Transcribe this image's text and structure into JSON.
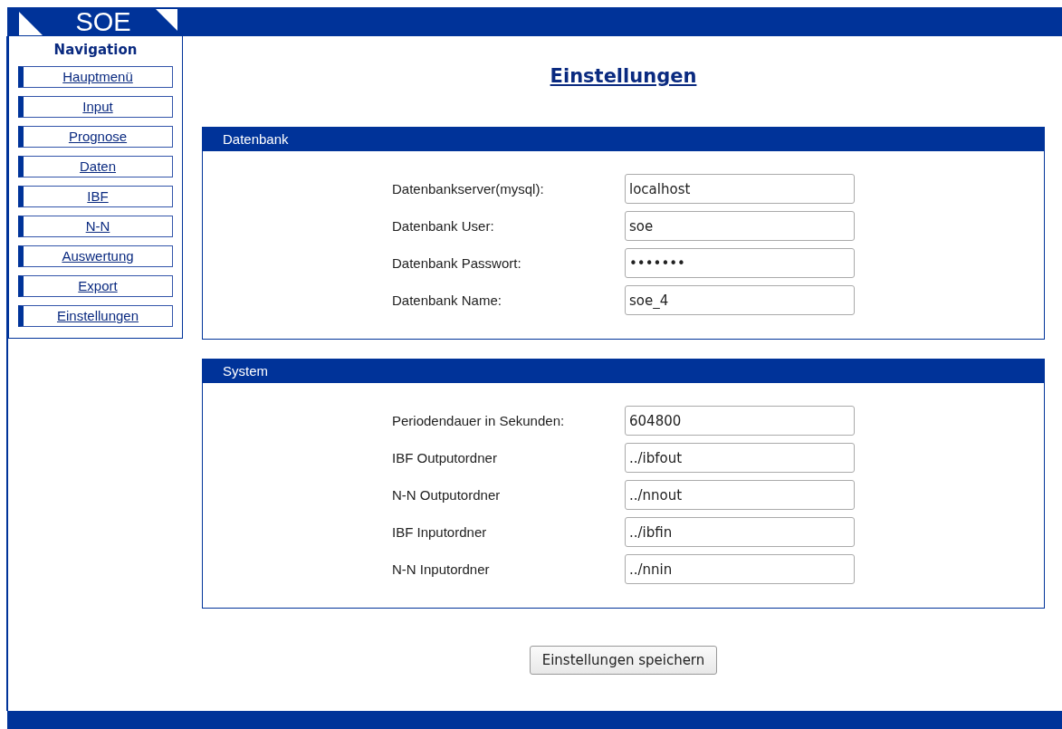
{
  "logo": "SOE",
  "navigation": {
    "title": "Navigation",
    "items": [
      {
        "label": "Hauptmenü",
        "selected": false
      },
      {
        "label": "Input",
        "selected": false
      },
      {
        "label": "Prognose",
        "selected": false
      },
      {
        "label": "Daten",
        "selected": false
      },
      {
        "label": "IBF",
        "selected": false
      },
      {
        "label": "N-N",
        "selected": false
      },
      {
        "label": "Auswertung",
        "selected": false
      },
      {
        "label": "Export",
        "selected": false
      },
      {
        "label": "Einstellungen",
        "selected": false
      }
    ]
  },
  "page_title": "Einstellungen",
  "sections": [
    {
      "title": "Datenbank",
      "fields": [
        {
          "label": "Datenbankserver(mysql):",
          "value": "localhost"
        },
        {
          "label": "Datenbank User:",
          "value": "soe"
        },
        {
          "label": "Datenbank Passwort:",
          "value": "•••••••"
        },
        {
          "label": "Datenbank Name:",
          "value": "soe_4"
        }
      ]
    },
    {
      "title": "System",
      "fields": [
        {
          "label": "Periodendauer in Sekunden:",
          "value": "604800"
        },
        {
          "label": "IBF Outputordner",
          "value": "../ibfout"
        },
        {
          "label": "N-N Outputordner",
          "value": "../nnout"
        },
        {
          "label": "IBF Inputordner",
          "value": "../ibfin"
        },
        {
          "label": "N-N Inputordner",
          "value": "../nnin"
        }
      ]
    }
  ],
  "save_button": "Einstellungen speichern"
}
